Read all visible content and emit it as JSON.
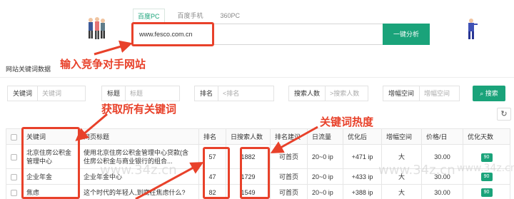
{
  "tabs": [
    {
      "label": "百度PC",
      "active": true
    },
    {
      "label": "百度手机",
      "active": false
    },
    {
      "label": "360PC",
      "active": false
    }
  ],
  "search": {
    "value": "www.fesco.com.cn",
    "button_label": "一键分析"
  },
  "annotations": {
    "input_site": "输入竞争对手网站",
    "get_keywords": "获取所有关键词",
    "keyword_heat": "关键词热度"
  },
  "section_title": "网站关键词数据",
  "filters": [
    {
      "label": "关键词",
      "placeholder": "关键词"
    },
    {
      "label": "标题",
      "placeholder": "标题"
    },
    {
      "label": "排名",
      "placeholder": "<排名"
    },
    {
      "label": "搜索人数",
      "placeholder": ">搜索人数"
    },
    {
      "label": "增幅空间",
      "placeholder": "增幅空间"
    }
  ],
  "search_small_label": "搜索",
  "refresh_icon": "↻",
  "table": {
    "headers": [
      "关键词",
      "网页标题",
      "排名",
      "日搜索人数",
      "排名建议",
      "日流量",
      "优化后",
      "增幅空间",
      "价格/日",
      "优化天数"
    ],
    "rows": [
      {
        "keyword": "北京住房公积金管理中心",
        "title": "使用北京住房公积金管理中心贷款(含住房公积金与商业银行的组合...",
        "rank": "57",
        "daily_search": "1882",
        "suggest": "可首页",
        "daily_flow": "20~0 ip",
        "optimized": "+471 ip",
        "space": "大",
        "price": "30.00",
        "days": "90"
      },
      {
        "keyword": "企业年金",
        "title": "企业年金中心",
        "rank": "47",
        "daily_search": "1729",
        "suggest": "可首页",
        "daily_flow": "20~0 ip",
        "optimized": "+433 ip",
        "space": "大",
        "price": "30.00",
        "days": "90"
      },
      {
        "keyword": "焦虑",
        "title": "这个时代的年轻人,到底在焦虑什么?",
        "rank": "82",
        "daily_search": "1549",
        "suggest": "可首页",
        "daily_flow": "20~0 ip",
        "optimized": "+388 ip",
        "space": "大",
        "price": "30.00",
        "days": "90"
      }
    ]
  },
  "watermarks": [
    "www.34z.cn",
    "www.34z.cn",
    "www.34z.cn"
  ],
  "colors": {
    "accent": "#1aa37a",
    "annotation_red": "#e8412a"
  }
}
